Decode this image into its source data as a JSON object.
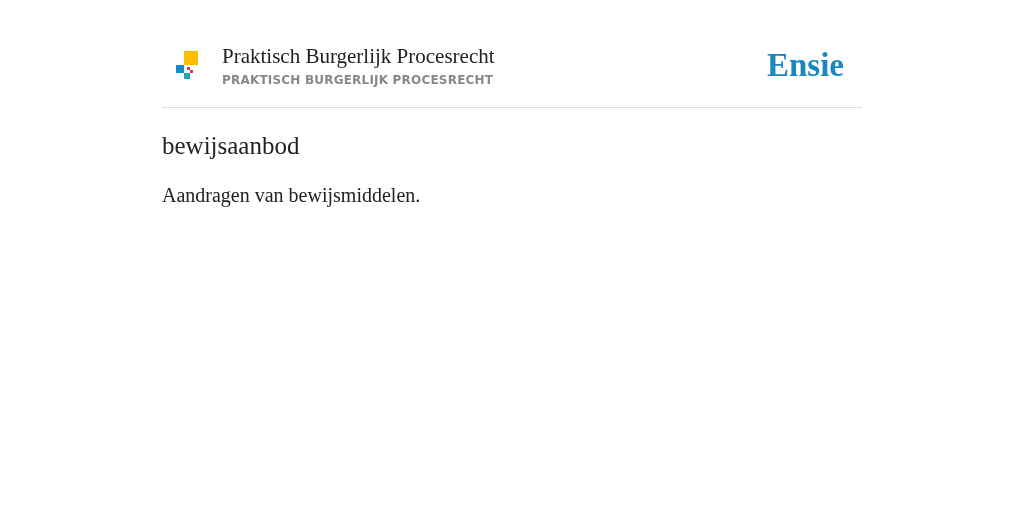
{
  "header": {
    "title": "Praktisch Burgerlijk Procesrecht",
    "subtitle": "PRAKTISCH BURGERLIJK PROCESRECHT",
    "brand": "Ensie"
  },
  "entry": {
    "term": "bewijsaanbod",
    "definition": "Aandragen van bewijsmiddelen."
  }
}
